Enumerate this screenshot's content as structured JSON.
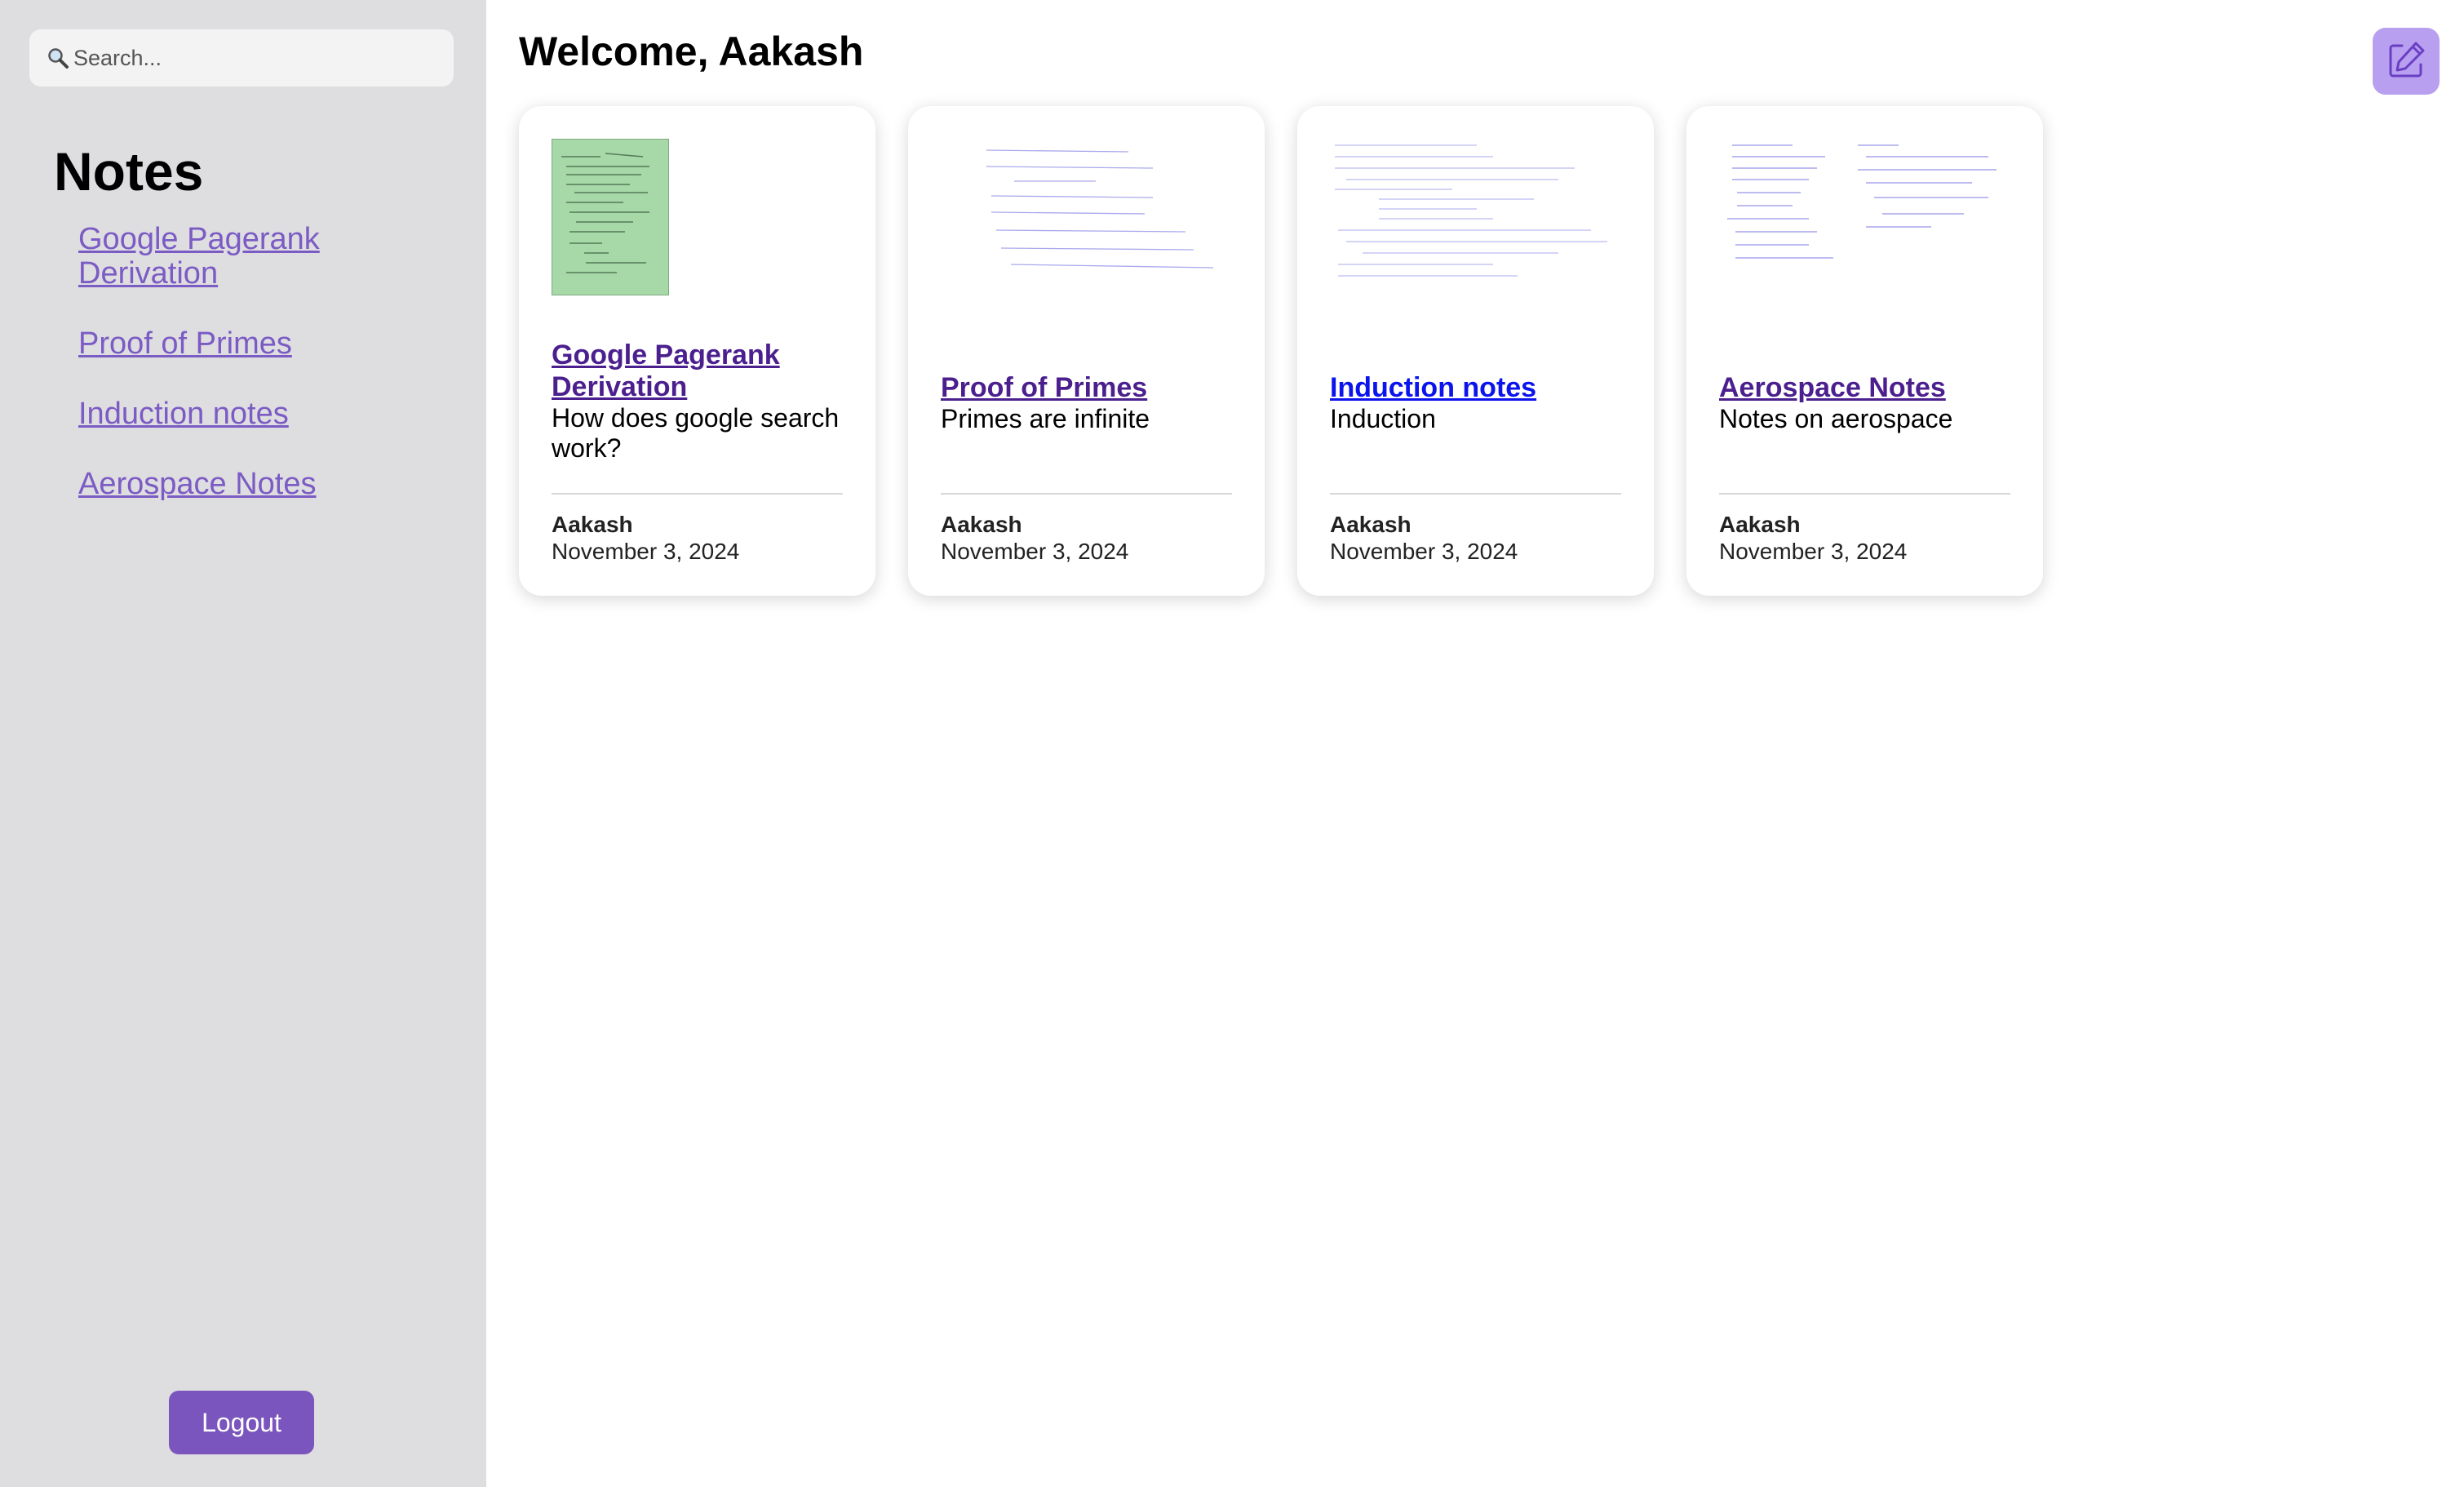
{
  "search": {
    "placeholder": "Search..."
  },
  "sidebar": {
    "title": "Notes",
    "items": [
      {
        "label": "Google Pagerank Derivation"
      },
      {
        "label": "Proof of Primes"
      },
      {
        "label": "Induction notes"
      },
      {
        "label": "Aerospace Notes"
      }
    ],
    "logout_label": "Logout"
  },
  "main": {
    "title": "Welcome, Aakash",
    "cards": [
      {
        "title": "Google Pagerank Derivation",
        "description": "How does google search work?",
        "author": "Aakash",
        "date": "November 3, 2024"
      },
      {
        "title": "Proof of Primes",
        "description": "Primes are infinite",
        "author": "Aakash",
        "date": "November 3, 2024"
      },
      {
        "title": "Induction notes",
        "description": "Induction",
        "author": "Aakash",
        "date": "November 3, 2024"
      },
      {
        "title": "Aerospace Notes",
        "description": "Notes on aerospace",
        "author": "Aakash",
        "date": "November 3, 2024"
      }
    ]
  },
  "icons": {
    "search": "search-icon",
    "compose": "edit-note-icon"
  },
  "colors": {
    "sidebar_bg": "#dedde0",
    "link_purple": "#7b5bc4",
    "title_purple": "#4b1f8e",
    "title_blue": "#0b14ec",
    "button_purple": "#7a55bd",
    "compose_bg": "#b89ff0"
  }
}
